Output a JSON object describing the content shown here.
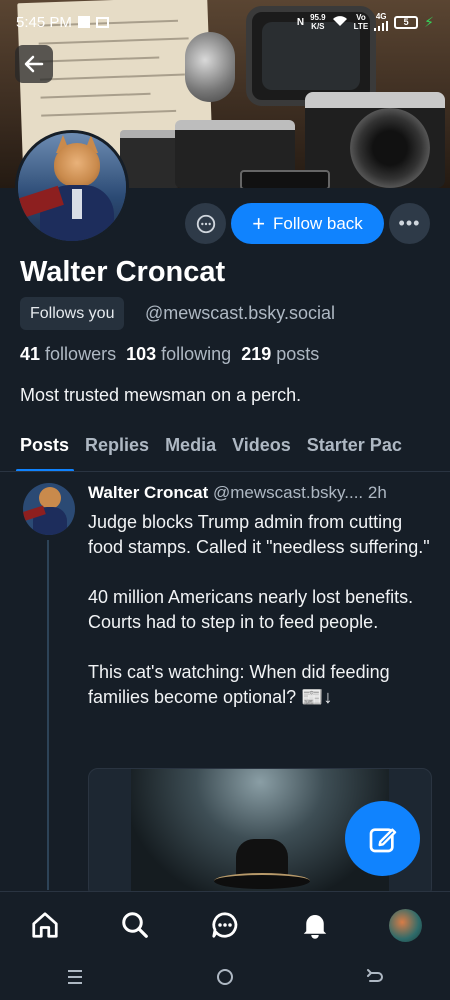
{
  "status_bar": {
    "time": "5:45 PM",
    "network_speed": "95.9",
    "speed_unit": "K/S",
    "volte": "Vo",
    "lte": "LTE",
    "signal_type": "4G",
    "battery": "5"
  },
  "profile": {
    "display_name": "Walter Croncat",
    "follows_you_badge": "Follows you",
    "handle": "@mewscast.bsky.social",
    "followers_count": "41",
    "followers_label": "followers",
    "following_count": "103",
    "following_label": "following",
    "posts_count": "219",
    "posts_label": "posts",
    "bio": "Most trusted mewsman on a perch."
  },
  "actions": {
    "follow_back_label": "Follow back",
    "follow_back_plus": "+",
    "more_label": "•••"
  },
  "tabs": [
    {
      "label": "Posts",
      "active": true
    },
    {
      "label": "Replies",
      "active": false
    },
    {
      "label": "Media",
      "active": false
    },
    {
      "label": "Videos",
      "active": false
    },
    {
      "label": "Starter Pac",
      "active": false
    }
  ],
  "post": {
    "author_name": "Walter Croncat",
    "author_handle": "@mewscast.bsky....",
    "time_ago": "2h",
    "text": "Judge blocks Trump admin from cutting food stamps. Called it \"needless suffering.\"\n\n40 million Americans nearly lost benefits. Courts had to step in to feed people.\n\nThis cat's watching: When did feeding families become optional? 📰↓"
  },
  "nav": {
    "items": [
      "home-icon",
      "search-icon",
      "chat-icon",
      "bell-icon",
      "avatar"
    ]
  },
  "colors": {
    "background": "#161e27",
    "accent": "#1083fe",
    "secondary_text": "#aeb8c3"
  }
}
